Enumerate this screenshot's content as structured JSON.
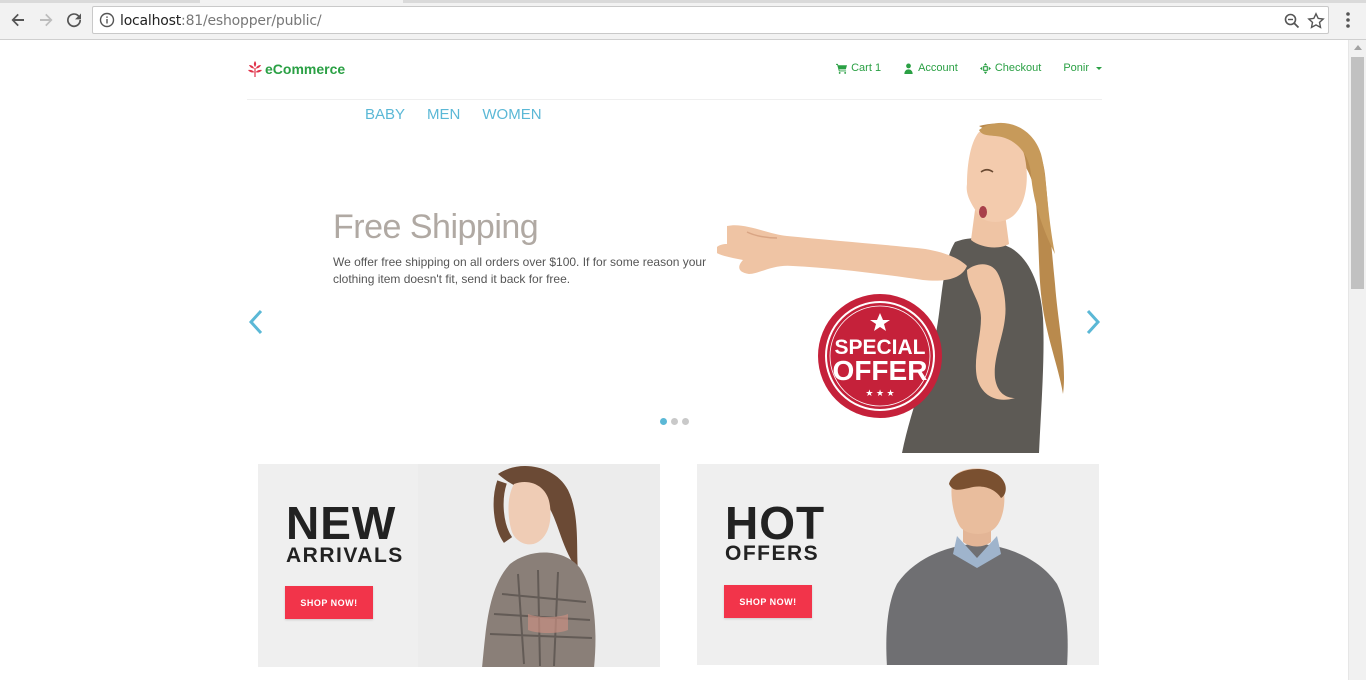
{
  "browser": {
    "url_host": "localhost",
    "url_port": ":81",
    "url_path": "/eshopper/public/"
  },
  "header": {
    "brand": "eCommerce",
    "nav": {
      "cart": "Cart 1",
      "account": "Account",
      "checkout": "Checkout",
      "user": "Ponir"
    }
  },
  "categories": [
    "BABY",
    "MEN",
    "WOMEN"
  ],
  "slider": {
    "title": "Free Shipping",
    "text": "We offer free shipping on all orders over $100. If for some reason your clothing item doesn't fit, send it back for free.",
    "badge_top": "SPECIAL",
    "badge_bottom": "OFFER",
    "slide_count": 3,
    "active_slide": 1
  },
  "banners": {
    "left": {
      "big": "NEW",
      "small": "ARRIVALS",
      "button": "SHOP NOW!"
    },
    "right": {
      "big": "HOT",
      "small": "OFFERS",
      "button": "SHOP NOW!"
    }
  },
  "colors": {
    "brand_green": "#2aa044",
    "accent_blue": "#5bb8d6",
    "badge_red": "#c5213a",
    "button_red": "#f2344a"
  },
  "icons": {
    "back": "arrow-left-icon",
    "forward": "arrow-right-icon",
    "reload": "reload-icon",
    "info": "info-icon",
    "zoom": "zoom-icon",
    "bookmark": "star-icon",
    "menu": "more-vert-icon",
    "cart": "cart-icon",
    "account": "user-icon",
    "checkout": "crosshair-icon",
    "logo": "leaf-icon"
  }
}
